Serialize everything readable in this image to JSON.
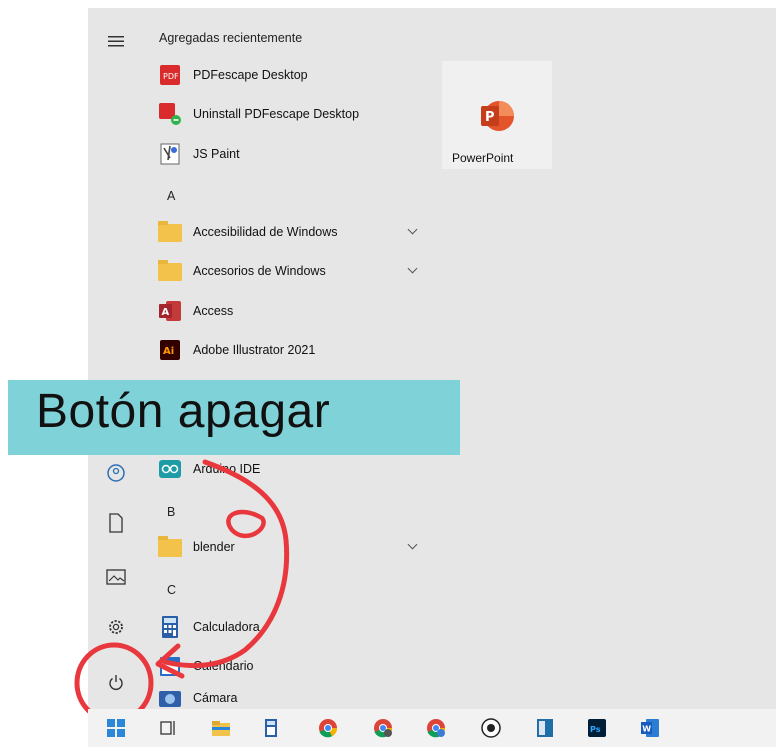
{
  "start_menu": {
    "recent_header": "Agregadas recientemente",
    "recent_apps": [
      {
        "label": "PDFescape Desktop",
        "icon": "pdfescape-icon"
      },
      {
        "label": "Uninstall PDFescape Desktop",
        "icon": "pdfescape-uninstall-icon"
      },
      {
        "label": "JS Paint",
        "icon": "jspaint-icon"
      }
    ],
    "sections": [
      {
        "letter": "A",
        "items": [
          {
            "label": "Accesibilidad de Windows",
            "icon": "folder-icon",
            "expandable": true
          },
          {
            "label": "Accesorios de Windows",
            "icon": "folder-icon",
            "expandable": true
          },
          {
            "label": "Access",
            "icon": "access-icon"
          },
          {
            "label": "Adobe Illustrator 2021",
            "icon": "illustrator-icon"
          },
          {
            "label": "Arduino IDE",
            "icon": "arduino-icon"
          }
        ]
      },
      {
        "letter": "B",
        "items": [
          {
            "label": "blender",
            "icon": "folder-icon",
            "expandable": true
          }
        ]
      },
      {
        "letter": "C",
        "items": [
          {
            "label": "Calculadora",
            "icon": "calculator-icon"
          },
          {
            "label": "Calendario",
            "icon": "calendar-icon"
          },
          {
            "label": "Cámara",
            "icon": "camera-icon"
          }
        ]
      }
    ],
    "pinned_tile": {
      "label": "PowerPoint",
      "icon": "powerpoint-icon"
    }
  },
  "rail_icons": [
    "hamburger-icon",
    "user-icon",
    "documents-icon",
    "pictures-icon",
    "settings-icon",
    "power-icon"
  ],
  "annotation": {
    "text": "Botón apagar",
    "banner_color": "#7fd2d8",
    "marker_color": "#e8383d"
  },
  "taskbar_icons": [
    "windows-start-icon",
    "task-view-icon",
    "file-explorer-icon",
    "calculator-icon",
    "chrome-icon",
    "chrome-icon",
    "chrome-icon",
    "obs-icon",
    "app-icon",
    "photoshop-icon",
    "word-icon"
  ]
}
